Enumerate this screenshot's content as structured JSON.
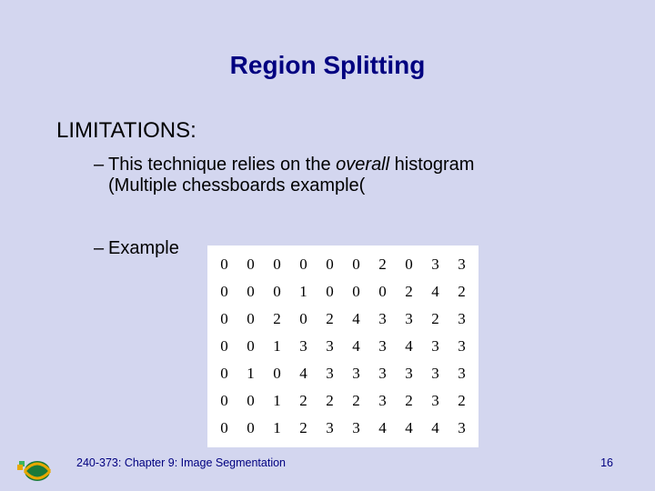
{
  "title": "Region Splitting",
  "section_heading": "LIMITATIONS",
  "colon": ":",
  "bullets": {
    "b1_dash": "–",
    "b1_pre": "This technique relies on the ",
    "b1_em": "overall",
    "b1_post": " histogram",
    "b1_wrap": "(Multiple chessboards example(",
    "b2_dash": "–",
    "b2_text": "Example"
  },
  "footer": {
    "left": "240-373: Chapter 9: Image Segmentation",
    "right": "16"
  },
  "chart_data": {
    "type": "table",
    "title": "",
    "rows": 8,
    "cols": 10,
    "values": [
      [
        0,
        0,
        0,
        0,
        0,
        0,
        2,
        0,
        3,
        3
      ],
      [
        0,
        0,
        0,
        1,
        0,
        0,
        0,
        2,
        4,
        2
      ],
      [
        0,
        0,
        2,
        0,
        2,
        4,
        3,
        3,
        2,
        3
      ],
      [
        0,
        0,
        1,
        3,
        3,
        4,
        3,
        4,
        3,
        3
      ],
      [
        0,
        1,
        0,
        4,
        3,
        3,
        3,
        3,
        3,
        3
      ],
      [
        0,
        0,
        1,
        2,
        2,
        2,
        3,
        2,
        3,
        2
      ],
      [
        0,
        0,
        1,
        2,
        3,
        3,
        4,
        4,
        4,
        3
      ]
    ]
  }
}
